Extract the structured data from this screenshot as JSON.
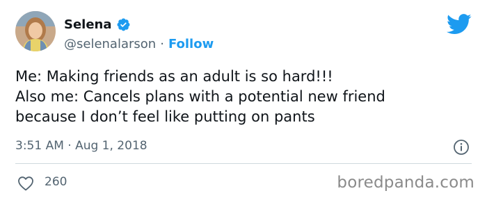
{
  "author": {
    "name": "Selena",
    "handle": "@selenalarson",
    "separator": "·",
    "follow_label": "Follow"
  },
  "tweet": {
    "lines": [
      "Me: Making friends as an adult is so hard!!!",
      "Also me: Cancels plans with a potential new friend",
      "because I don’t feel like putting on pants"
    ],
    "timestamp": "3:51 AM · Aug 1, 2018"
  },
  "engagement": {
    "likes": "260"
  },
  "watermark": "boredpanda.com",
  "icons": {
    "verified": "verified-badge-icon",
    "brand": "twitter-bird-icon",
    "info": "info-icon",
    "like": "heart-icon"
  },
  "colors": {
    "accent": "#1d9bf0",
    "text": "#0f1419",
    "secondary": "#536471",
    "divider": "#cfd9de",
    "watermark": "#8a8a8a"
  }
}
